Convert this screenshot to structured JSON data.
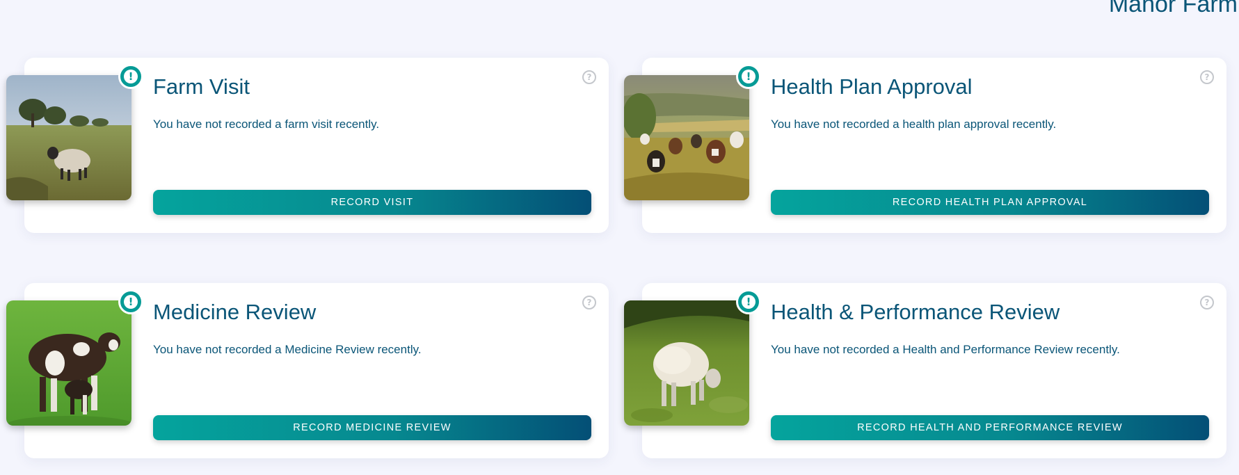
{
  "header": {
    "farm_name": "Manor Farm"
  },
  "colors": {
    "background": "#f4f5fd",
    "text": "#0a5577",
    "accent": "#069b96",
    "button_gradient_start": "#05a49d",
    "button_gradient_end": "#044f76"
  },
  "cards": [
    {
      "title": "Farm Visit",
      "message": "You have not recorded a farm visit recently.",
      "button_label": "RECORD VISIT",
      "image": "sheep-in-field-photo",
      "alert_icon": "exclamation-icon",
      "alert_glyph": "!",
      "help_icon": "question-mark-icon",
      "help_glyph": "?"
    },
    {
      "title": "Health Plan Approval",
      "message": "You have not recorded a health plan approval recently.",
      "button_label": "RECORD HEALTH PLAN APPROVAL",
      "image": "cattle-herd-photo",
      "alert_icon": "exclamation-icon",
      "alert_glyph": "!",
      "help_icon": "question-mark-icon",
      "help_glyph": "?"
    },
    {
      "title": "Medicine Review",
      "message": "You have not recorded a Medicine Review recently.",
      "button_label": "RECORD MEDICINE REVIEW",
      "image": "cow-and-calf-photo",
      "alert_icon": "exclamation-icon",
      "alert_glyph": "!",
      "help_icon": "question-mark-icon",
      "help_glyph": "?"
    },
    {
      "title": "Health & Performance Review",
      "message": "You have not recorded a Health and Performance Review recently.",
      "button_label": "RECORD HEALTH AND PERFORMANCE REVIEW",
      "image": "grazing-sheep-photo",
      "alert_icon": "exclamation-icon",
      "alert_glyph": "!",
      "help_icon": "question-mark-icon",
      "help_glyph": "?"
    }
  ]
}
